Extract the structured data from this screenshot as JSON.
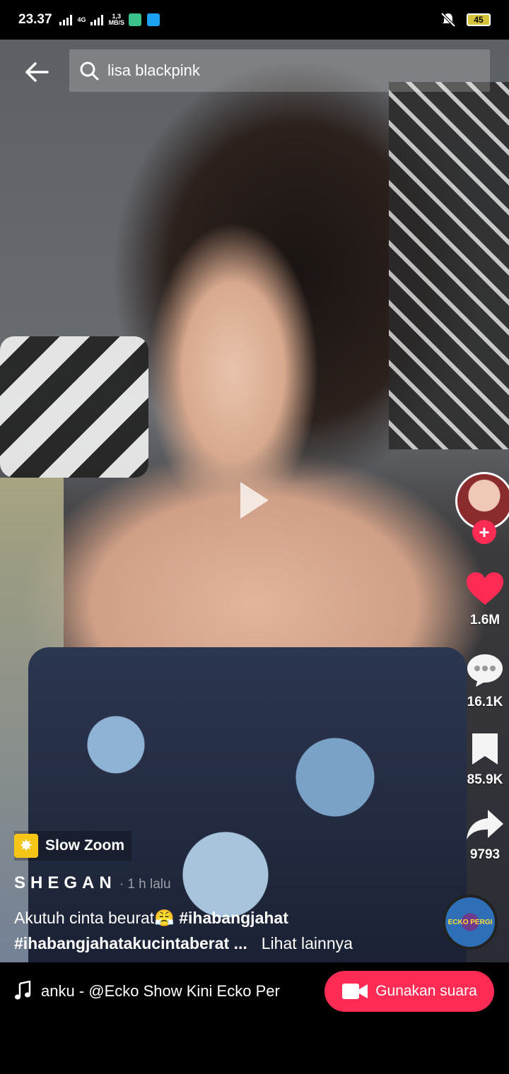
{
  "status_bar": {
    "time": "23.37",
    "network_label": "4G",
    "speed_value": "1,3",
    "speed_unit": "MB/S",
    "battery": "45",
    "icons": [
      "signal-icon",
      "signal-icon",
      "app-notification-icon",
      "twitter-icon",
      "mute-icon",
      "battery-icon"
    ]
  },
  "header": {
    "search_query": "lisa blackpink"
  },
  "rail": {
    "likes": "1.6M",
    "comments": "16.1K",
    "saves": "85.9K",
    "shares": "9793",
    "follow_symbol": "+",
    "disc_label": "ECKO PERGI"
  },
  "post": {
    "effect": "Slow Zoom",
    "author": "SHEGAN",
    "time_ago": "· 1 h lalu",
    "caption_text": "Akutuh cinta beurat😤 ",
    "caption_tag1": "#ihabangjahat",
    "caption_tag2": "#ihabangjahatakucintaberat ...",
    "see_more": "Lihat lainnya"
  },
  "sound": {
    "marquee": "anku - @Ecko Show     Kini Ecko Per",
    "use_sound_label": "Gunakan suara"
  },
  "colors": {
    "accent": "#fe2c55",
    "like": "#fe2c55",
    "effect_icon_bg": "#f5c518"
  }
}
